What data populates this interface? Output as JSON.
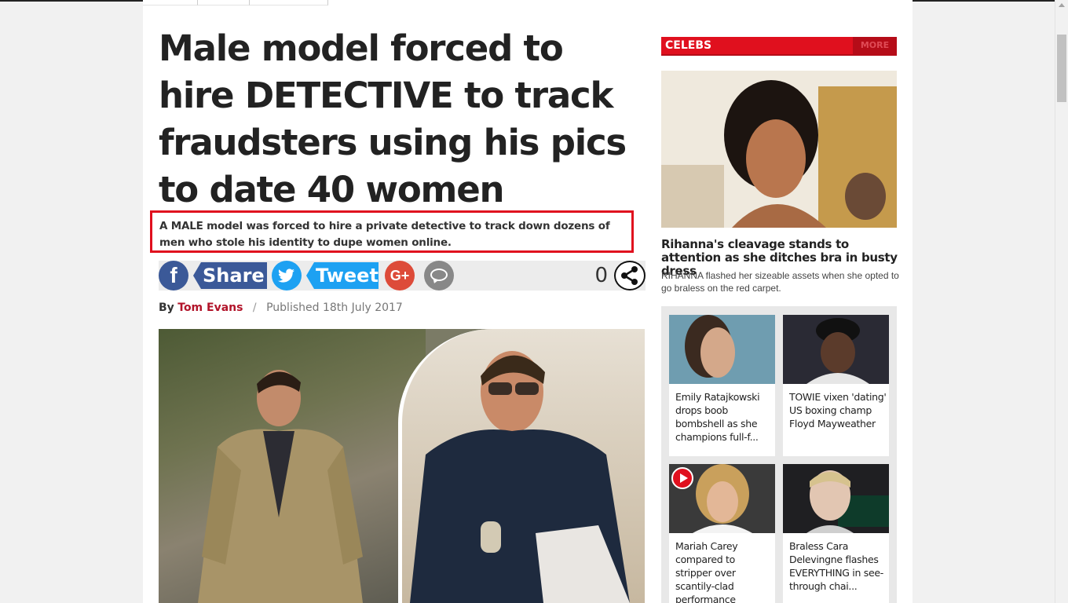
{
  "article": {
    "headline": "Male model forced to hire DETECTIVE to track fraudsters using his pics to date 40 women",
    "standfirst": "A MALE model was forced to hire a private detective to track down dozens of men who stole his identity to dupe women online.",
    "byline": {
      "by": "By",
      "author": "Tom Evans",
      "separator": "/",
      "published": "Published 18th July 2017"
    }
  },
  "share": {
    "facebook_icon": "f",
    "facebook_label": "Share",
    "twitter_label": "Tweet",
    "google_label": "G+",
    "count": "0",
    "icons": [
      "facebook-icon",
      "twitter-icon",
      "google-plus-icon",
      "comment-icon",
      "share-icon"
    ]
  },
  "sidebar": {
    "section_label": "CELEBS",
    "more_label": "MORE",
    "feature": {
      "title": "Rihanna's cleavage stands to attention as she ditches bra in busty dress",
      "description": "RIHANNA flashed her sizeable assets when she opted to go braless on the red carpet."
    },
    "cards": [
      {
        "text": "Emily Ratajkowski drops boob bombshell as she champions full-f..."
      },
      {
        "text": "TOWIE vixen 'dating' US boxing champ Floyd Mayweather"
      },
      {
        "text": "Mariah Carey compared to stripper over scantily-clad performance"
      },
      {
        "text": "Braless Cara Delevingne flashes EVERYTHING in see-through chai..."
      }
    ]
  },
  "colors": {
    "brand_red": "#e0101e",
    "facebook": "#3b5998",
    "twitter": "#1da1f2",
    "google": "#dd4b39",
    "author": "#b2142a"
  }
}
